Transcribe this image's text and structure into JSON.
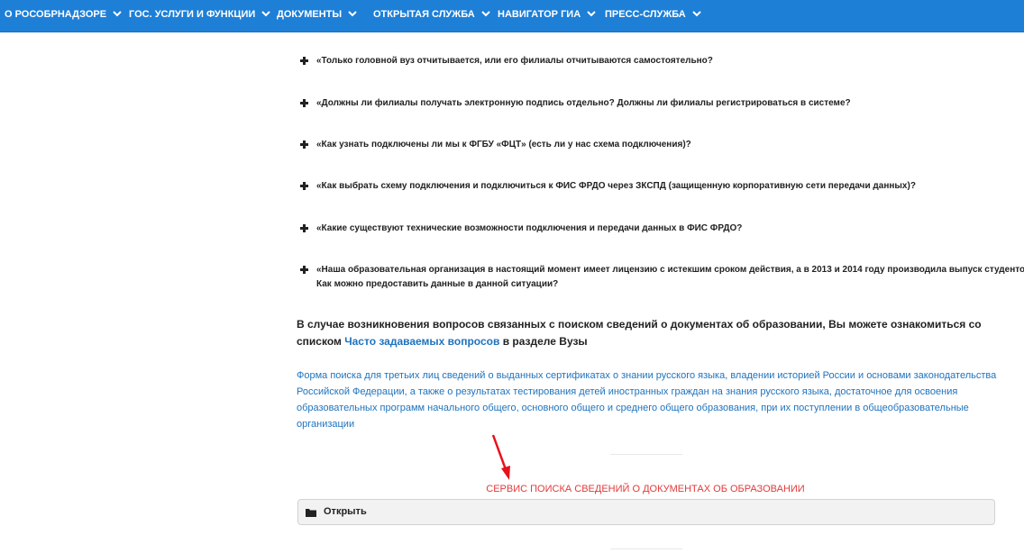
{
  "nav": {
    "items": [
      {
        "label": "О РОСОБРНАДЗОРЕ"
      },
      {
        "label": "ГОС. УСЛУГИ И ФУНКЦИИ"
      },
      {
        "label": "ДОКУМЕНТЫ"
      },
      {
        "label": "ОТКРЫТАЯ СЛУЖБА"
      },
      {
        "label": "НАВИГАТОР ГИА"
      },
      {
        "label": "ПРЕСС-СЛУЖБА"
      }
    ]
  },
  "faq": {
    "items": [
      {
        "text": "«Только головной вуз отчитывается, или его филиалы отчитываются самостоятельно?"
      },
      {
        "text": "«Должны ли филиалы получать электронную подпись отдельно? Должны ли филиалы регистрироваться в системе?"
      },
      {
        "text": "«Как узнать подключены ли мы к ФГБУ «ФЦТ» (есть ли у нас схема подключения)?"
      },
      {
        "text": "«Как выбрать схему подключения и подключиться к ФИС ФРДО через ЗКСПД (защищенную корпоративную сети передачи данных)?"
      },
      {
        "text": "«Какие существуют технические возможности подключения и передачи данных в ФИС ФРДО?"
      },
      {
        "text": "«Наша образовательная организация в настоящий момент имеет лицензию с истекшим сроком действия, а в 2013 и 2014 году производила выпуск студентов.",
        "text2": "Как можно предоставить данные в данной ситуации?"
      }
    ]
  },
  "note": {
    "text_before": "В случае возникновения вопросов связанных с поиском сведений о документах об образовании, Вы можете ознакомиться со списком ",
    "link": "Часто задаваемых вопросов",
    "text_after": " в разделе Вузы"
  },
  "form_link": "Форма поиска для третьих лиц сведений о выданных сертификатах о знании русского языка, владении историей России и основами законодательства Российской Федерации, а также о результатах тестирования детей иностранных граждан на знания русского языка, достаточное для освоения образовательных программ начального общего, основного общего и среднего общего образования, при их поступлении в общеобразовательные организации",
  "service": {
    "label": "СЕРВИС ПОИСКА СВЕДЕНИЙ О ДОКУМЕНТАХ ОБ ОБРАЗОВАНИИ",
    "open_label": "Открыть"
  },
  "icons": {
    "nav_chevron": "chevron-down-icon",
    "faq_expand": "plus-icon",
    "spoiler": "folder-icon",
    "annotation": "red-arrow"
  },
  "colors": {
    "nav_bg": "#1e7fd6",
    "link": "#1e73be",
    "accent_red": "#e23a3a"
  }
}
